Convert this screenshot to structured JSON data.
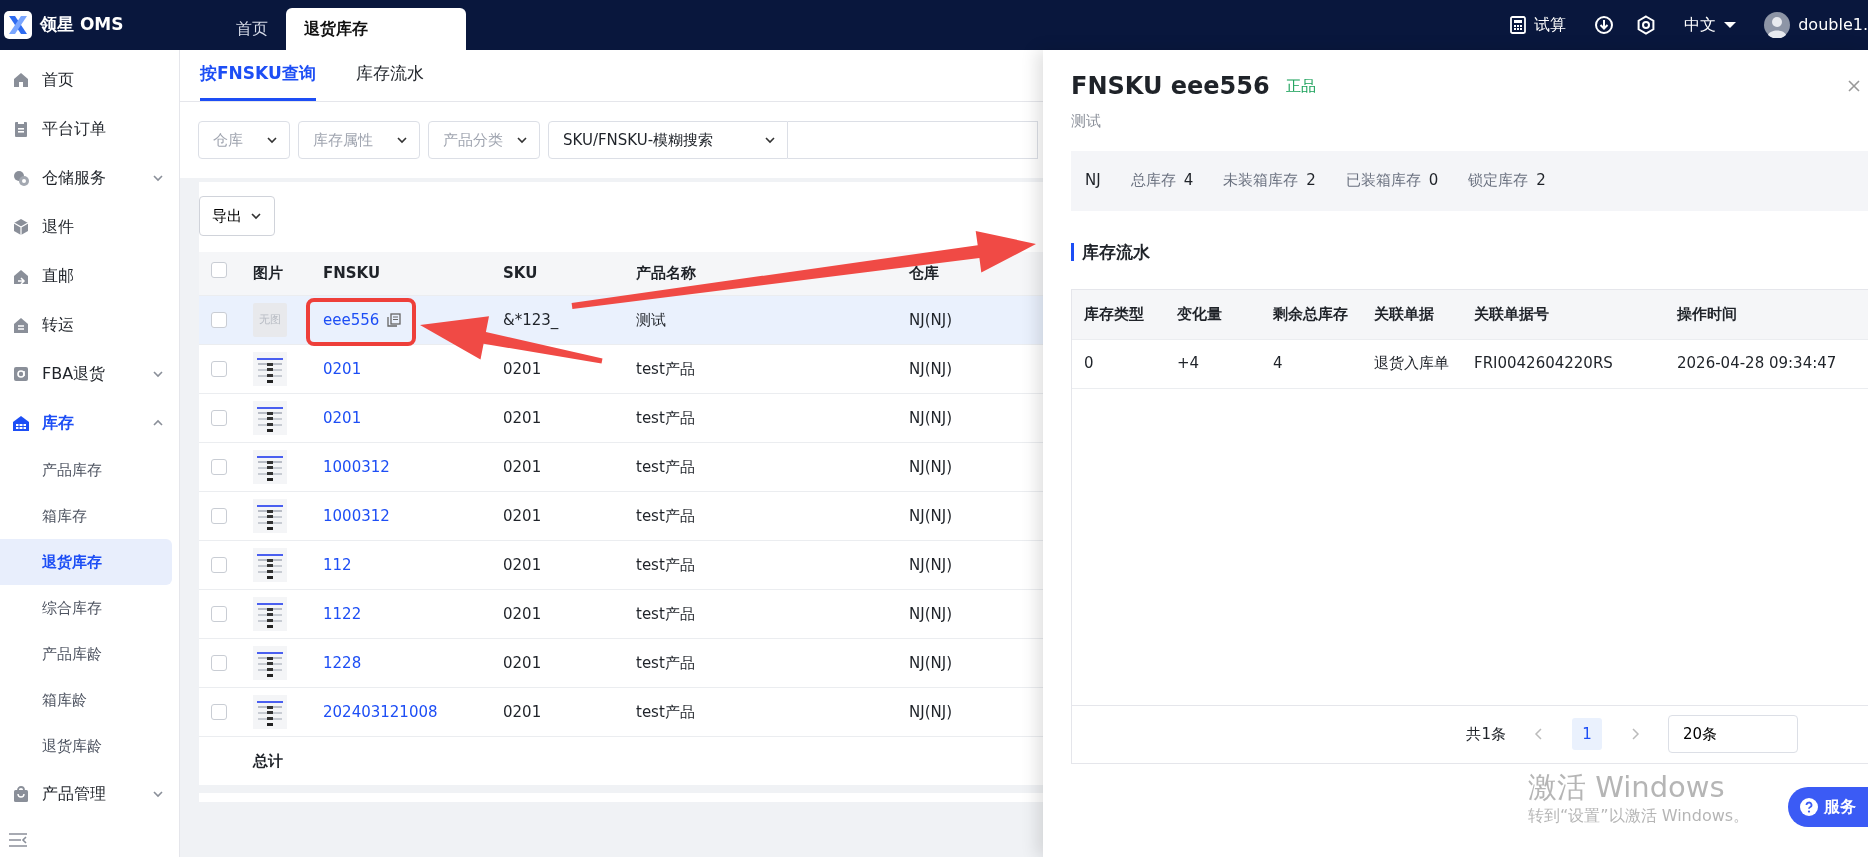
{
  "app": {
    "logo_text": "领星 OMS"
  },
  "top_tabs": [
    {
      "label": "首页",
      "selected": false
    },
    {
      "label": "退货库存",
      "selected": true
    }
  ],
  "header_actions": {
    "trial": "试算",
    "language": "中文",
    "user": "double1."
  },
  "sidebar": {
    "items": [
      {
        "label": "首页",
        "kind": "link",
        "selected": false
      },
      {
        "label": "平台订单",
        "kind": "link",
        "selected": false
      },
      {
        "label": "仓储服务",
        "kind": "group",
        "expanded": false,
        "selected": false
      },
      {
        "label": "退件",
        "kind": "link",
        "selected": false
      },
      {
        "label": "直邮",
        "kind": "link",
        "selected": false
      },
      {
        "label": "转运",
        "kind": "link",
        "selected": false
      },
      {
        "label": "FBA退货",
        "kind": "group",
        "expanded": false,
        "selected": false
      },
      {
        "label": "库存",
        "kind": "group",
        "expanded": true,
        "selected": true,
        "children": [
          {
            "label": "产品库存",
            "selected": false
          },
          {
            "label": "箱库存",
            "selected": false
          },
          {
            "label": "退货库存",
            "selected": true
          },
          {
            "label": "综合库存",
            "selected": false
          },
          {
            "label": "产品库龄",
            "selected": false
          },
          {
            "label": "箱库龄",
            "selected": false
          },
          {
            "label": "退货库龄",
            "selected": false
          }
        ]
      },
      {
        "label": "产品管理",
        "kind": "group",
        "expanded": false,
        "selected": false
      }
    ]
  },
  "sub_tabs": [
    {
      "label": "按FNSKU查询",
      "selected": true
    },
    {
      "label": "库存流水",
      "selected": false
    }
  ],
  "filters": [
    {
      "placeholder": "仓库"
    },
    {
      "placeholder": "库存属性"
    },
    {
      "placeholder": "产品分类"
    },
    {
      "value": "SKU/FNSKU-模糊搜索"
    }
  ],
  "export_button": "导出",
  "table": {
    "select_all_checked": false,
    "columns": [
      "图片",
      "FNSKU",
      "SKU",
      "产品名称",
      "仓库"
    ],
    "rows": [
      {
        "checked": false,
        "highlighted": true,
        "image": {
          "kind": "placeholder",
          "text": "无图"
        },
        "fnsku": "eee556",
        "sku": "&*123_",
        "name": "测试",
        "warehouse": "NJ(NJ)"
      },
      {
        "checked": false,
        "highlighted": false,
        "fnsku": "0201",
        "sku": "0201",
        "name": "test产品",
        "warehouse": "NJ(NJ)"
      },
      {
        "checked": false,
        "highlighted": false,
        "fnsku": "0201",
        "sku": "0201",
        "name": "test产品",
        "warehouse": "NJ(NJ)"
      },
      {
        "checked": false,
        "highlighted": false,
        "fnsku": "1000312",
        "sku": "0201",
        "name": "test产品",
        "warehouse": "NJ(NJ)"
      },
      {
        "checked": false,
        "highlighted": false,
        "fnsku": "1000312",
        "sku": "0201",
        "name": "test产品",
        "warehouse": "NJ(NJ)"
      },
      {
        "checked": false,
        "highlighted": false,
        "fnsku": "112",
        "sku": "0201",
        "name": "test产品",
        "warehouse": "NJ(NJ)"
      },
      {
        "checked": false,
        "highlighted": false,
        "fnsku": "1122",
        "sku": "0201",
        "name": "test产品",
        "warehouse": "NJ(NJ)"
      },
      {
        "checked": false,
        "highlighted": false,
        "fnsku": "1228",
        "sku": "0201",
        "name": "test产品",
        "warehouse": "NJ(NJ)"
      },
      {
        "checked": false,
        "highlighted": false,
        "fnsku": "202403121008",
        "sku": "0201",
        "name": "test产品",
        "warehouse": "NJ(NJ)"
      }
    ],
    "total_label": "总计"
  },
  "drawer": {
    "title": "FNSKU eee556",
    "tag": "正品",
    "subtitle": "测试",
    "summary": {
      "warehouse": "NJ",
      "stats": [
        {
          "label": "总库存",
          "value": "4"
        },
        {
          "label": "未装箱库存",
          "value": "2"
        },
        {
          "label": "已装箱库存",
          "value": "0"
        },
        {
          "label": "锁定库存",
          "value": "2"
        }
      ]
    },
    "section_title": "库存流水",
    "table": {
      "columns": [
        "库存类型",
        "变化量",
        "剩余总库存",
        "关联单据",
        "关联单据号",
        "操作时间"
      ],
      "rows": [
        [
          "0",
          "+4",
          "4",
          "退货入库单",
          "FRI0042604220RS",
          "2026-04-28 09:34:47"
        ]
      ]
    },
    "pagination": {
      "total": "共1条",
      "pages": [
        {
          "label": "1",
          "selected": true
        }
      ],
      "page_size": "20条"
    }
  },
  "service_button": "服务",
  "windows_activation": {
    "title": "激活 Windows",
    "subtitle": "转到“设置”以激活 Windows。"
  }
}
